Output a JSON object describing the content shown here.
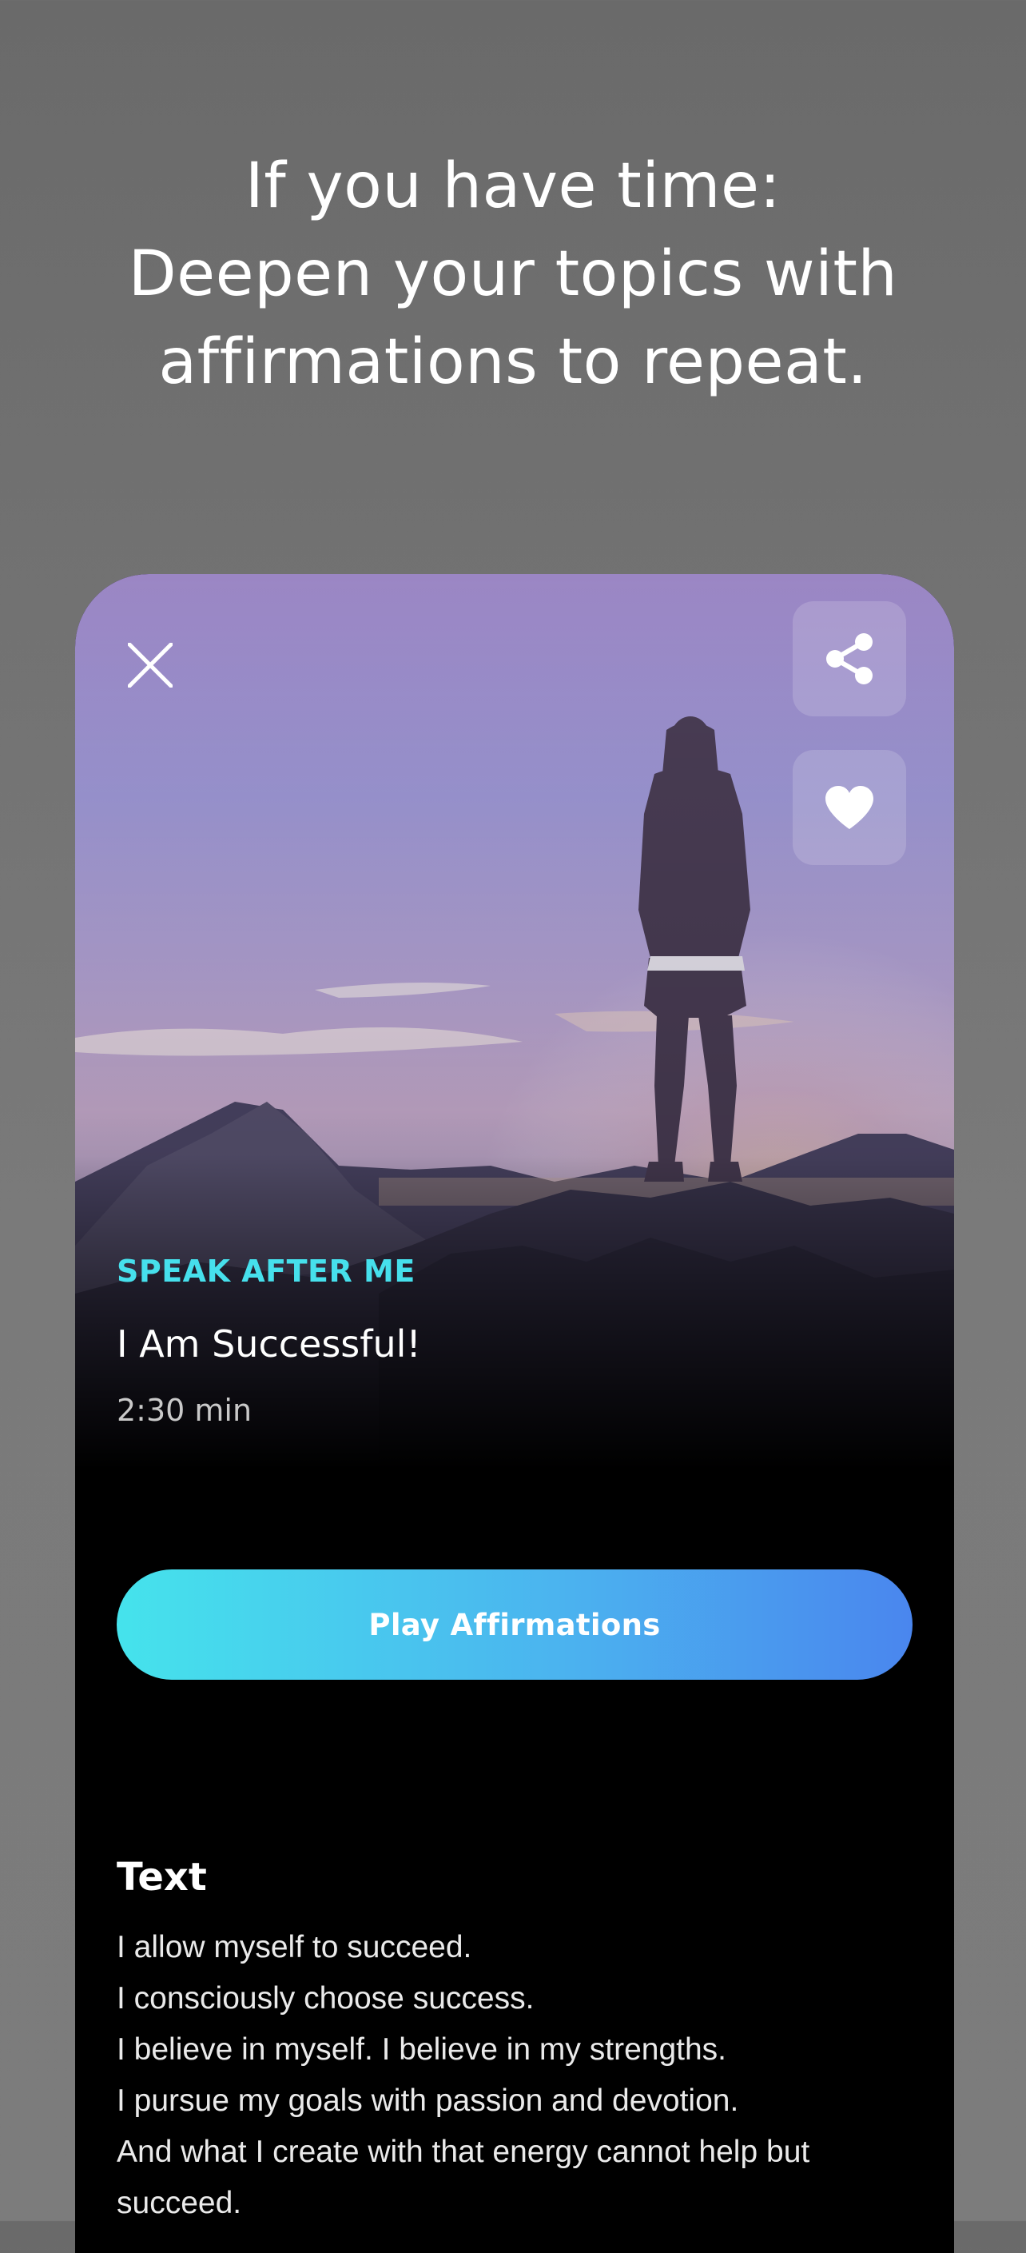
{
  "header": {
    "line1": "If you have time:",
    "line2": "Deepen your topics with",
    "line3": "affirmations to repeat."
  },
  "card": {
    "eyebrow": "SPEAK AFTER ME",
    "title": "I Am Successful!",
    "duration": "2:30 min",
    "play_label": "Play Affirmations",
    "text_heading": "Text",
    "text_lines": [
      "I allow myself to succeed.",
      "I consciously choose success.",
      "I believe in myself. I believe in my strengths.",
      "I pursue my goals with passion and devotion.",
      "And what I create with that energy cannot help but succeed."
    ]
  },
  "icons": {
    "close": "close-icon",
    "share": "share-icon",
    "heart": "heart-icon"
  },
  "colors": {
    "accent": "#46e0ec",
    "button_start": "#45e3ec",
    "button_end": "#4a86ee",
    "background": "#707070"
  }
}
